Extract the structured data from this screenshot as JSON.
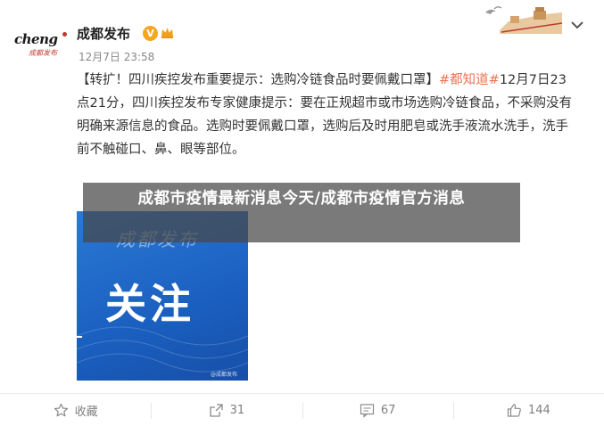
{
  "account": {
    "logo_text": "cheng",
    "logo_subtext": "成都发布",
    "name": "成都发布",
    "verified_mark": "V",
    "timestamp": "12月7日 23:58"
  },
  "post": {
    "text_parts": [
      "【转扩！四川疾控发布重要提示：选购冷链食品时要佩戴口罩】",
      "#都知道#",
      "12月7日23点21分，四川疾控发布专家健康提示：要在正规超市或市场选购冷链食品，不采购没有明确来源信息的食品。选购时要佩戴口罩，选购后及时用肥皂或洗手液流水洗手，洗手前不触碰口、鼻、眼等部位。"
    ],
    "image": {
      "brand_text": "成都发布",
      "headline": "关注",
      "watermark": "@成都发布"
    }
  },
  "overlay": {
    "title": "成都市疫情最新消息今天/成都市疫情官方消息"
  },
  "actions": [
    {
      "icon": "star-icon",
      "label": "收藏"
    },
    {
      "icon": "share-icon",
      "label": "31"
    },
    {
      "icon": "comment-icon",
      "label": "67"
    },
    {
      "icon": "like-icon",
      "label": "144"
    }
  ],
  "colors": {
    "hashtag": "#eb7350",
    "verified": "#f5a623",
    "image_blue": "#1a5fbf",
    "overlay": "rgba(70,70,70,0.72)"
  }
}
